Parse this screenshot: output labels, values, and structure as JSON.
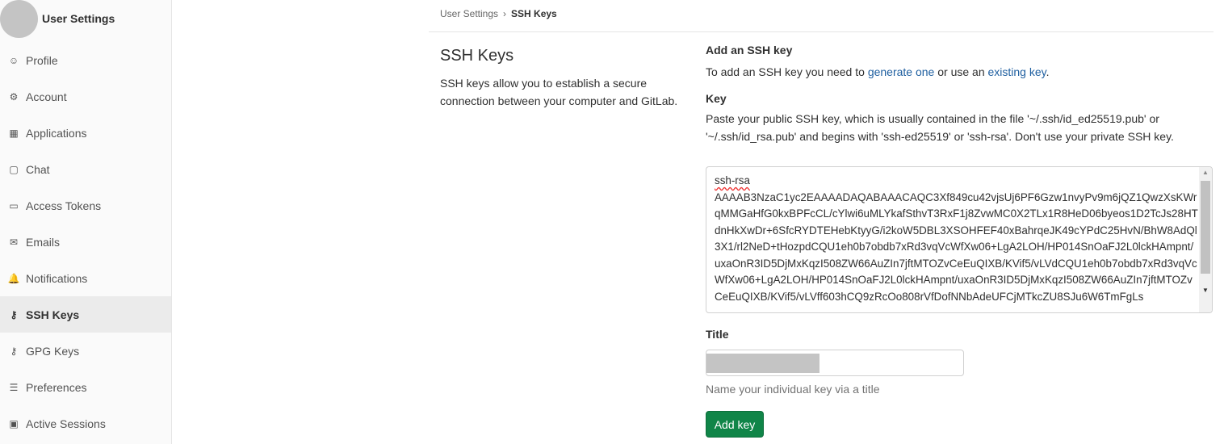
{
  "sidebar": {
    "context_title": "User Settings",
    "items": [
      {
        "label": "Profile",
        "icon": "profile-icon",
        "glyph": "☺"
      },
      {
        "label": "Account",
        "icon": "account-icon",
        "glyph": "⚙"
      },
      {
        "label": "Applications",
        "icon": "applications-icon",
        "glyph": "▦"
      },
      {
        "label": "Chat",
        "icon": "chat-icon",
        "glyph": "▢"
      },
      {
        "label": "Access Tokens",
        "icon": "token-icon",
        "glyph": "▭"
      },
      {
        "label": "Emails",
        "icon": "email-icon",
        "glyph": "✉"
      },
      {
        "label": "Notifications",
        "icon": "bell-icon",
        "glyph": "🔔"
      },
      {
        "label": "SSH Keys",
        "icon": "key-icon",
        "glyph": "⚷"
      },
      {
        "label": "GPG Keys",
        "icon": "key-icon",
        "glyph": "⚷"
      },
      {
        "label": "Preferences",
        "icon": "preferences-icon",
        "glyph": "☰"
      },
      {
        "label": "Active Sessions",
        "icon": "sessions-icon",
        "glyph": "▣"
      }
    ]
  },
  "breadcrumb": {
    "parent": "User Settings",
    "current": "SSH Keys"
  },
  "page": {
    "title": "SSH Keys",
    "description": "SSH keys allow you to establish a secure connection between your computer and GitLab."
  },
  "form": {
    "heading": "Add an SSH key",
    "intro_prefix": "To add an SSH key you need to ",
    "intro_link1": "generate one",
    "intro_mid": " or use an ",
    "intro_link2": "existing key",
    "intro_suffix": ".",
    "key_label": "Key",
    "key_help": "Paste your public SSH key, which is usually contained in the file '~/.ssh/id_ed25519.pub' or '~/.ssh/id_rsa.pub' and begins with 'ssh-ed25519' or 'ssh-rsa'. Don't use your private SSH key.",
    "key_value_first": "ssh-rsa",
    "key_value_rest": "AAAAB3NzaC1yc2EAAAADAQABAAACAQC3Xf849cu42vjsUj6PF6Gzw1nvyPv9m6jQZ1QwzXsKWrqMMGaHfG0kxBPFcCL/cYlwi6uMLYkafSthvT3RxF1j8ZvwMC0X2TLx1R8HeD06byeos1D2TcJs28HTdnHkXwDr+6SfcRYDTEHebKtyyG/i2koW5DBL3XSOHFEF40xBahrqeJK49cYPdC25HvN/BhW8AdQl3X1/rl2NeD+tHozpdCQU1eh0b7obdb7xRd3vqVcWfXw06+LgA2LOH/HP014SnOaFJ2L0lckHAmpnt/uxaOnR3ID5DjMxKqzI508ZW66AuZIn7jftMTOZvCeEuQIXB/KVif5/vLVdCQU1eh0b7obdb7xRd3vqVcWfXw06+LgA2LOH/HP014SnOaFJ2L0lckHAmpnt/uxaOnR3ID5DjMxKqzI508ZW66AuZIn7jftMTOZvCeEuQIXB/KVif5/vLVff603hCQ9zRcOo808rVfDofNNbAdeUFCjMTkcZU8SJu6W6TmFgLs",
    "title_label": "Title",
    "title_help": "Name your individual key via a title",
    "submit_label": "Add key",
    "accent": "#108548"
  }
}
